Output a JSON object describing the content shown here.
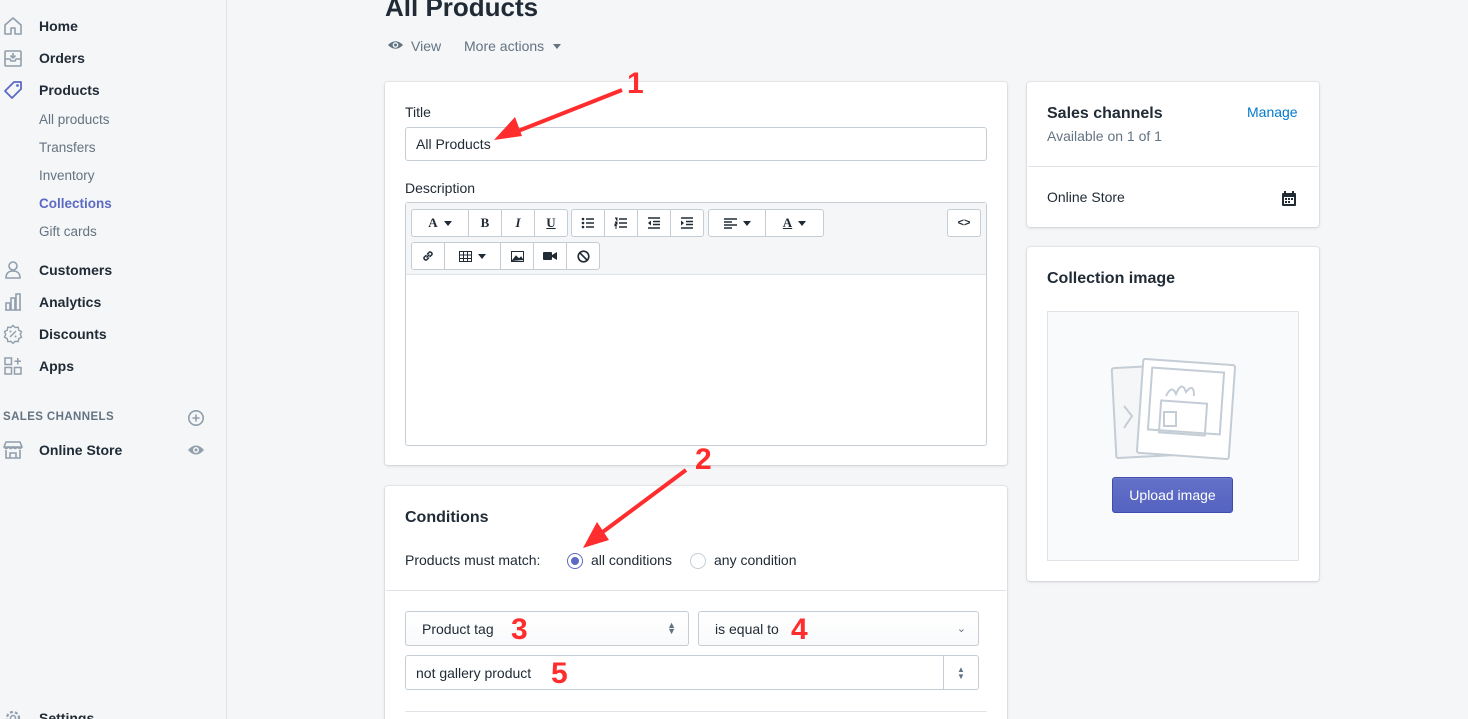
{
  "sidebar": {
    "items": [
      {
        "label": "Home",
        "icon": "home-icon"
      },
      {
        "label": "Orders",
        "icon": "orders-icon"
      },
      {
        "label": "Products",
        "icon": "tag-icon"
      },
      {
        "label": "Customers",
        "icon": "person-icon"
      },
      {
        "label": "Analytics",
        "icon": "bar-chart-icon"
      },
      {
        "label": "Discounts",
        "icon": "discount-icon"
      },
      {
        "label": "Apps",
        "icon": "apps-icon"
      }
    ],
    "product_subitems": [
      "All products",
      "Transfers",
      "Inventory",
      "Collections",
      "Gift cards"
    ],
    "active_subitem": "Collections",
    "sales_channels_heading": "SALES CHANNELS",
    "online_store_label": "Online Store",
    "settings_label": "Settings"
  },
  "header": {
    "title": "All Products",
    "view_label": "View",
    "more_actions_label": "More actions"
  },
  "form": {
    "title_label": "Title",
    "title_value": "All Products",
    "description_label": "Description",
    "toolbar": {
      "font_label": "A",
      "bold_label": "B",
      "italic_label": "I",
      "underline_label": "U",
      "color_label": "A",
      "code_label": "<>"
    }
  },
  "conditions": {
    "heading": "Conditions",
    "match_label": "Products must match:",
    "option_all": "all conditions",
    "option_any": "any condition",
    "selected": "all conditions",
    "field_select": "Product tag",
    "operator_select": "is equal to",
    "value": "not gallery product"
  },
  "sales_channels": {
    "heading": "Sales channels",
    "subtext": "Available on 1 of 1",
    "manage_label": "Manage",
    "channel_name": "Online Store"
  },
  "collection_image": {
    "heading": "Collection image",
    "upload_label": "Upload image"
  },
  "annotations": {
    "m1": "1",
    "m2": "2",
    "m3": "3",
    "m4": "4",
    "m5": "5",
    "color": "#ff2d2d"
  },
  "colors": {
    "accent": "#5c6ac4",
    "link": "#007ace",
    "background": "#f4f6f8"
  }
}
